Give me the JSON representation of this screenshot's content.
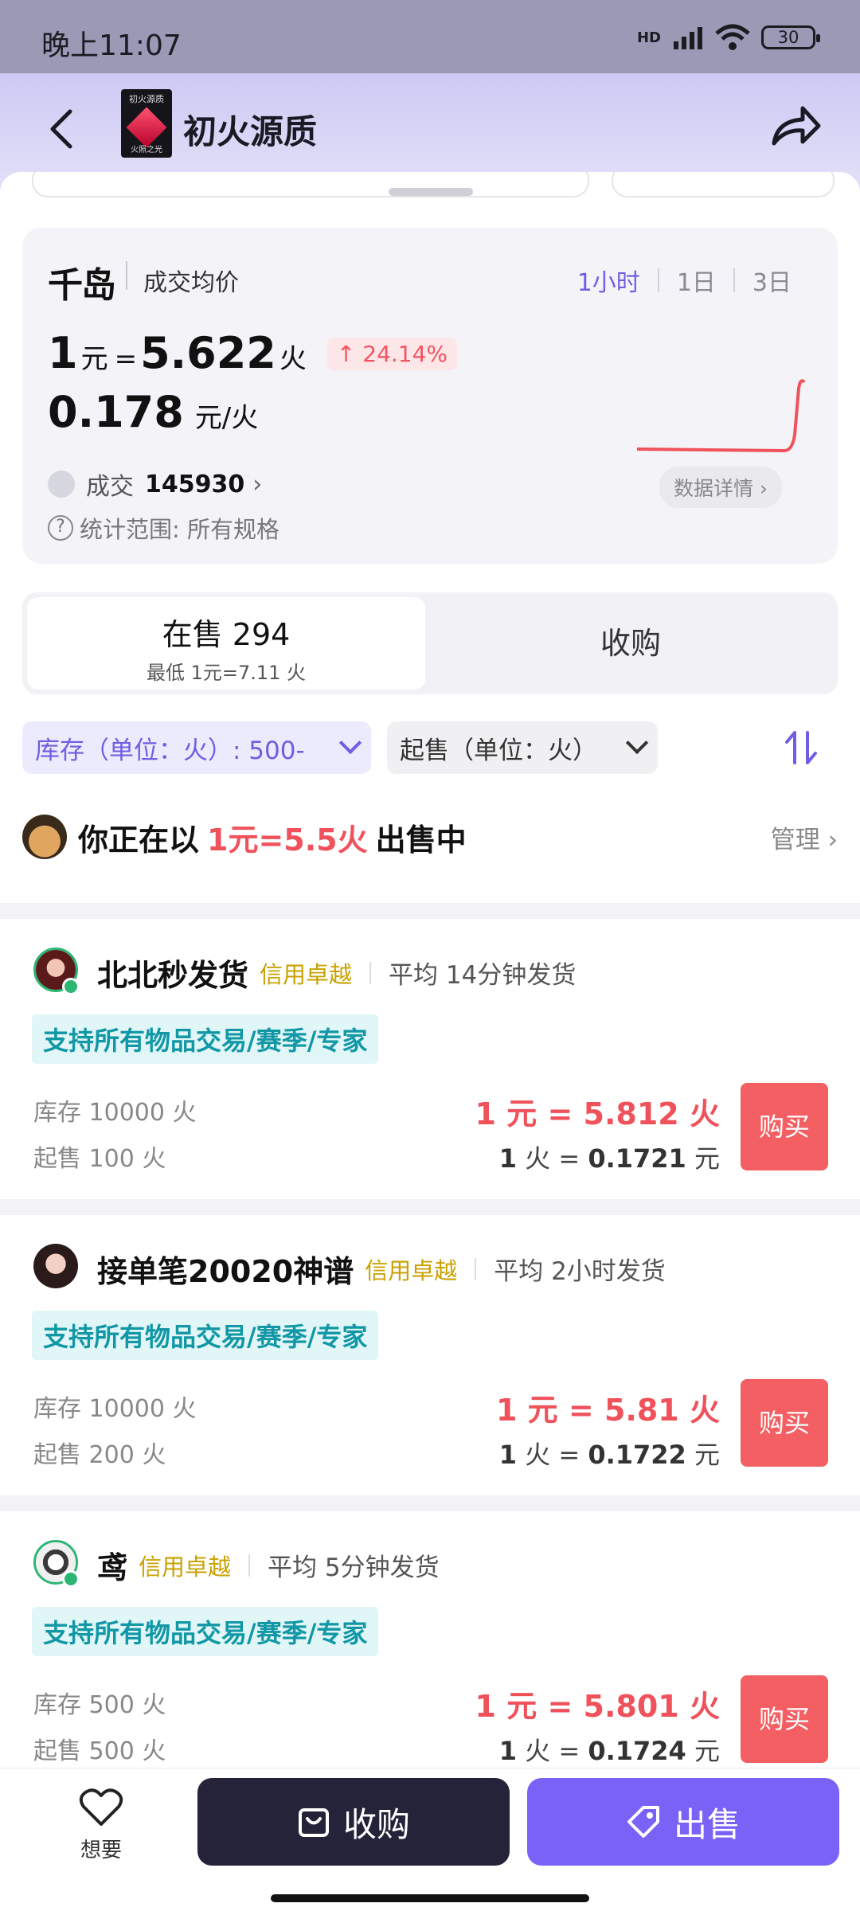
{
  "status_bar": {
    "time": "晚上11:07",
    "battery": "30",
    "network": "HD"
  },
  "header": {
    "title": "初火源质",
    "thumb_text_top": "初火源质",
    "thumb_text_bottom": "火照之光"
  },
  "price_card": {
    "brand": "千岛",
    "label": "成交均价",
    "ranges": [
      "1小时",
      "1日",
      "3日"
    ],
    "active_range": "1小时",
    "rate_prefix": "1",
    "rate_yuan_unit": "元",
    "rate_eq": "=",
    "rate_value": "5.622",
    "rate_fire_unit": "火",
    "change": "24.14%",
    "change_direction": "up",
    "inverse_value": "0.178",
    "inverse_unit": "元/火",
    "deal_label": "成交",
    "deal_count": "145930",
    "scope": "统计范围: 所有规格",
    "detail_button": "数据详情",
    "colors": {
      "accent": "#6f5fe0",
      "up": "#f25462"
    }
  },
  "sale_tabs": {
    "selling_label": "在售 294",
    "selling_sub": "最低 1元=7.11 火",
    "buying_label": "收购"
  },
  "filters": {
    "stock": "库存（单位：火）: 500-",
    "min_order": "起售（单位：火）"
  },
  "selling_banner": {
    "prefix": "你正在以",
    "rate": "1元=5.5火",
    "suffix": "出售中",
    "manage": "管理"
  },
  "sellers": [
    {
      "name": "北北秒发货",
      "credit": "信用卓越",
      "avg_ship": "平均 14分钟发货",
      "tag": "支持所有物品交易/赛季/专家",
      "stock": "库存 10000 火",
      "min": "起售 100 火",
      "rate_yuan": "1",
      "rate_fire": "5.812",
      "inv_fire": "1",
      "inv_yuan": "0.1721",
      "buy": "购买",
      "online": true
    },
    {
      "name": "接单笔20020神谱",
      "credit": "信用卓越",
      "avg_ship": "平均 2小时发货",
      "tag": "支持所有物品交易/赛季/专家",
      "stock": "库存 10000 火",
      "min": "起售 200 火",
      "rate_yuan": "1",
      "rate_fire": "5.81",
      "inv_fire": "1",
      "inv_yuan": "0.1722",
      "buy": "购买",
      "online": false
    },
    {
      "name": "鸢",
      "credit": "信用卓越",
      "avg_ship": "平均 5分钟发货",
      "tag": "支持所有物品交易/赛季/专家",
      "stock": "库存 500 火",
      "min": "起售 500 火",
      "rate_yuan": "1",
      "rate_fire": "5.801",
      "inv_fire": "1",
      "inv_yuan": "0.1724",
      "buy": "购买",
      "online": true
    }
  ],
  "unit_labels": {
    "yuan": "元",
    "fire": "火"
  },
  "bottom_bar": {
    "want": "想要",
    "purchase": "收购",
    "sell": "出售"
  },
  "icons": {
    "back": "back-icon",
    "share": "share-icon",
    "sort": "sort-icon",
    "heart": "heart-icon",
    "bag": "bag-icon",
    "tag": "tag-icon"
  }
}
